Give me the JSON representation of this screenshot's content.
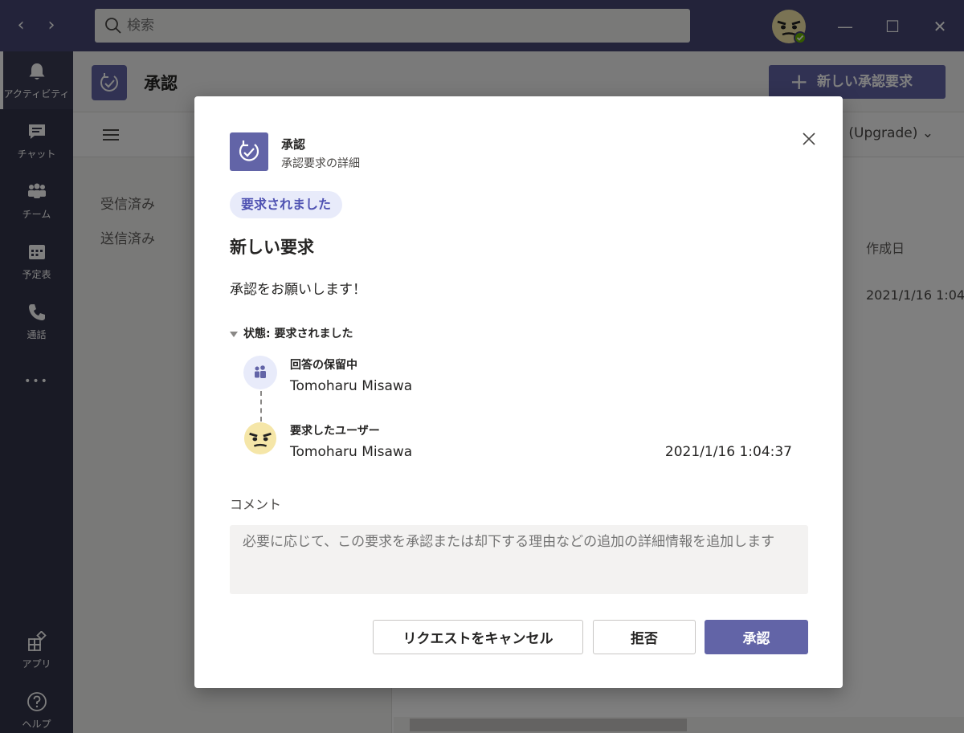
{
  "titlebar": {
    "back_glyph": "‹",
    "forward_glyph": "›",
    "search_placeholder": "検索",
    "minimize_glyph": "—",
    "maximize_glyph": "☐",
    "close_glyph": "✕"
  },
  "rail": {
    "items": [
      {
        "label": "アクティビティ",
        "icon": "bell-icon"
      },
      {
        "label": "チャット",
        "icon": "chat-icon"
      },
      {
        "label": "チーム",
        "icon": "teams-icon"
      },
      {
        "label": "予定表",
        "icon": "calendar-icon"
      },
      {
        "label": "通話",
        "icon": "phone-icon"
      }
    ],
    "more_glyph": "•••",
    "bottom": [
      {
        "label": "アプリ",
        "icon": "apps-icon"
      },
      {
        "label": "ヘルプ",
        "icon": "help-icon"
      }
    ]
  },
  "app": {
    "title": "承認",
    "new_request_label": "新しい承認要求",
    "upgrade_label": "(Upgrade)",
    "left_nav": [
      "受信済み",
      "送信済み"
    ],
    "column_created": "作成日",
    "row_date": "2021/1/16 1:04"
  },
  "dialog": {
    "app_name": "承認",
    "subtitle": "承認要求の詳細",
    "status_pill": "要求されました",
    "request_title": "新しい要求",
    "message": "承認をお願いします！",
    "state_label": "状態: 要求されました",
    "timeline": [
      {
        "status": "回答の保留中",
        "name": "Tomoharu Misawa",
        "time": ""
      },
      {
        "status": "要求したユーザー",
        "name": "Tomoharu Misawa",
        "time": "2021/1/16 1:04:37"
      }
    ],
    "comment_label": "コメント",
    "comment_placeholder": "必要に応じて、この要求を承認または却下する理由などの追加の詳細情報を追加します",
    "buttons": {
      "cancel_request": "リクエストをキャンセル",
      "reject": "拒否",
      "approve": "承認"
    }
  },
  "colors": {
    "brand": "#6264a7",
    "titlebar": "#464775",
    "rail": "#33344a",
    "presence": "#6bb700"
  }
}
